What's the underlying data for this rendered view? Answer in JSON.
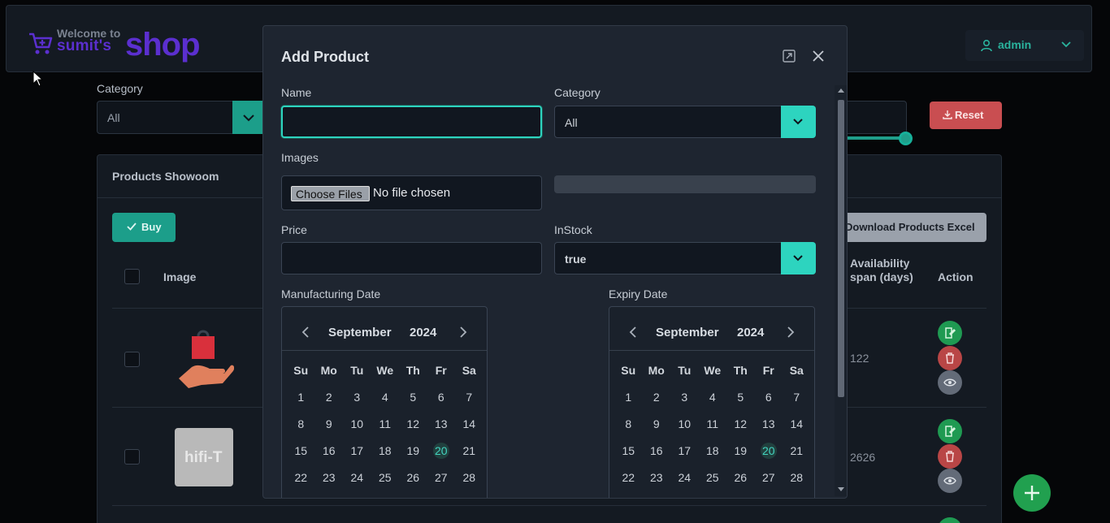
{
  "header": {
    "welcome": "Welcome to",
    "shop_name": "sumit's",
    "shop_word": "shop",
    "user": "admin"
  },
  "filters": {
    "category_label": "Category",
    "category_value": "All",
    "reset_label": "Reset"
  },
  "panel": {
    "title": "Products Showoom",
    "buy_label": "Buy",
    "download_label": "Download Products Excel",
    "col_image": "Image",
    "col_availability": "Availability span (days)",
    "col_action": "Action",
    "rows": [
      {
        "availability": "122",
        "image_text": ""
      },
      {
        "availability": "2626",
        "image_text": "hifi-T"
      }
    ]
  },
  "modal": {
    "title": "Add Product",
    "name_label": "Name",
    "name_value": "",
    "category_label": "Category",
    "category_value": "All",
    "images_label": "Images",
    "file_button": "Choose Files",
    "file_status": "No file chosen",
    "price_label": "Price",
    "price_value": "",
    "instock_label": "InStock",
    "instock_value": "true",
    "mfg_label": "Manufacturing Date",
    "exp_label": "Expiry Date"
  },
  "calendar": {
    "month": "September",
    "year": "2024",
    "weekdays": [
      "Su",
      "Mo",
      "Tu",
      "We",
      "Th",
      "Fr",
      "Sa"
    ],
    "weeks": [
      [
        "1",
        "2",
        "3",
        "4",
        "5",
        "6",
        "7"
      ],
      [
        "8",
        "9",
        "10",
        "11",
        "12",
        "13",
        "14"
      ],
      [
        "15",
        "16",
        "17",
        "18",
        "19",
        "20",
        "21"
      ],
      [
        "22",
        "23",
        "24",
        "25",
        "26",
        "27",
        "28"
      ]
    ],
    "today": "20"
  },
  "colors": {
    "accent": "#2dd4bf",
    "brand": "#5b2fcf",
    "danger": "#c94e51",
    "success": "#21a04f"
  }
}
